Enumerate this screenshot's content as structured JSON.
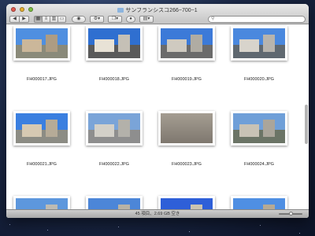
{
  "window": {
    "title": "サンフランシスコ266−700−1"
  },
  "toolbar": {
    "back_icon": "back-arrow-icon",
    "forward_icon": "forward-arrow-icon",
    "views": [
      "icon-view",
      "list-view",
      "column-view",
      "coverflow-view"
    ],
    "active_view": "icon-view",
    "search_placeholder": ""
  },
  "files": [
    {
      "name": "FH000017.JPG",
      "scene": "plaza"
    },
    {
      "name": "FH000018.JPG",
      "scene": "street"
    },
    {
      "name": "FH000019.JPG",
      "scene": "columns"
    },
    {
      "name": "FH000020.JPG",
      "scene": "tower"
    },
    {
      "name": "FH000021.JPG",
      "scene": "hall"
    },
    {
      "name": "FH000022.JPG",
      "scene": "cityhall"
    },
    {
      "name": "FH000023.JPG",
      "scene": "pigeons"
    },
    {
      "name": "FH000024.JPG",
      "scene": "corner"
    },
    {
      "name": "",
      "scene": "crowd"
    },
    {
      "name": "",
      "scene": "grand"
    },
    {
      "name": "",
      "scene": "blue"
    },
    {
      "name": "",
      "scene": "victorian"
    }
  ],
  "status": {
    "text": "45 項目、2.69 GB 空き"
  }
}
